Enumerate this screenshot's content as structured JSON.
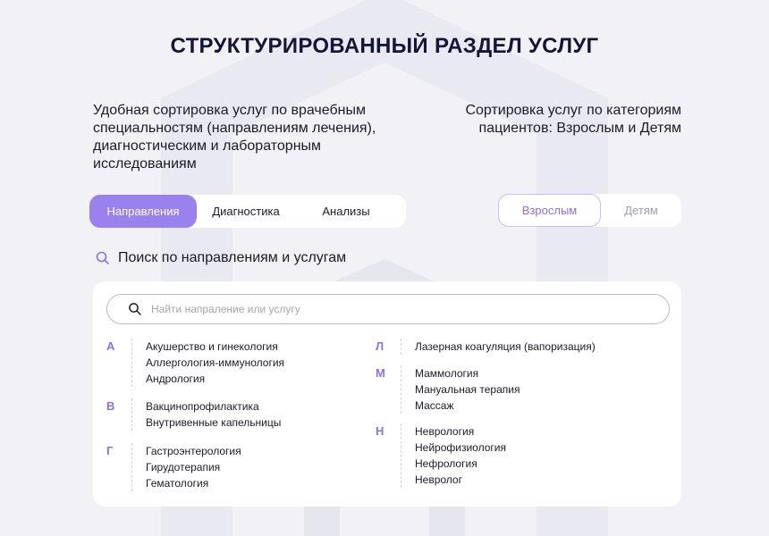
{
  "title": "СТРУКТУРИРОВАННЫЙ РАЗДЕЛ УСЛУГ",
  "description_left": "Удобная сортировка услуг по врачебным специальностям  (направлениям лечения), диагностическим и лабораторным исследованиям",
  "description_right": "Сортировка услуг по категориям пациентов: Взрослым и Детям",
  "tabs": [
    {
      "label": "Направления",
      "active": true
    },
    {
      "label": "Диагностика",
      "active": false
    },
    {
      "label": "Анализы",
      "active": false
    }
  ],
  "patient_tabs": [
    {
      "label": "Взрослым",
      "active": true
    },
    {
      "label": "Детям",
      "active": false
    }
  ],
  "search_heading": "Поиск по направлениям и услугам",
  "search": {
    "placeholder": "Найти напраление или услугу"
  },
  "colors": {
    "accent": "#9a82ee",
    "letter": "#8a70e6",
    "background": "#f2f2f6"
  },
  "groups_left": [
    {
      "letter": "А",
      "items": [
        "Акушерство и гинекология",
        "Аллергология-иммунология",
        "Андрология"
      ]
    },
    {
      "letter": "В",
      "items": [
        "Вакцинопрофилактика",
        "Внутривенные капельницы"
      ]
    },
    {
      "letter": "Г",
      "items": [
        "Гастроэнтерология",
        "Гирудотерапия",
        "Гематология"
      ]
    }
  ],
  "groups_right": [
    {
      "letter": "Л",
      "items": [
        "Лазерная коагуляция (вапоризация)"
      ]
    },
    {
      "letter": "М",
      "items": [
        "Маммология",
        "Мануальная терапия",
        "Массаж"
      ]
    },
    {
      "letter": "Н",
      "items": [
        "Неврология",
        "Нейрофизиология",
        "Нефрология",
        "Невролог"
      ]
    }
  ]
}
